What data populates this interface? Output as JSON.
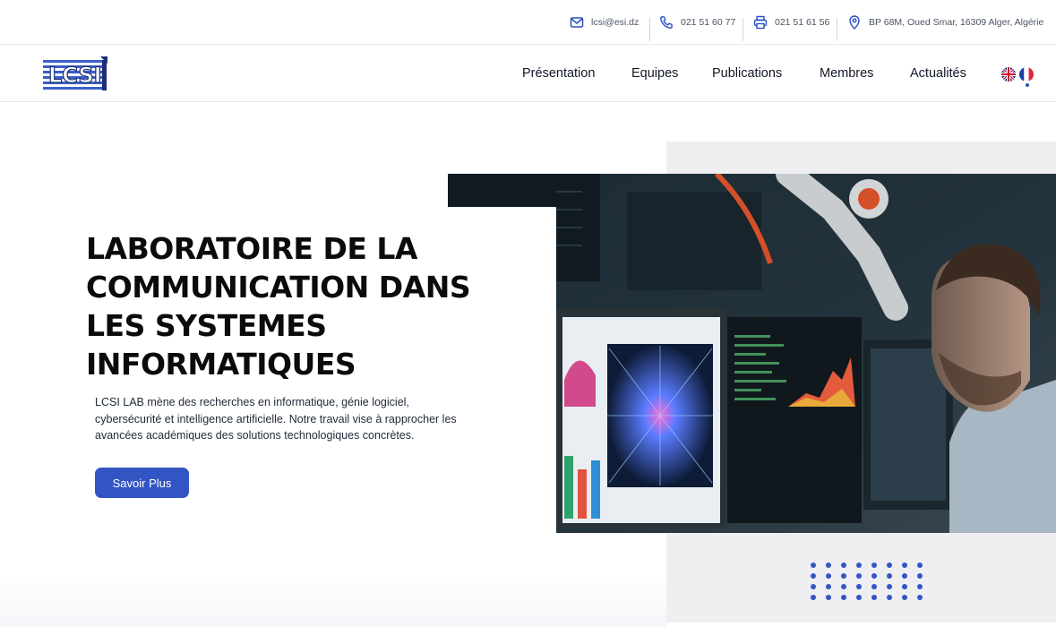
{
  "topbar": {
    "email": "lcsi@esi.dz",
    "phone": "021 51 60 77",
    "fax": "021 51 61 56",
    "address": "BP 68M, Oued Smar, 16309 Alger, Algérie",
    "icons": [
      "mail-icon",
      "phone-icon",
      "printer-icon",
      "location-pin-icon"
    ]
  },
  "navbar": {
    "logo_text": "LCSI",
    "items": [
      "Présentation",
      "Equipes",
      "Publications",
      "Membres",
      "Actualités"
    ],
    "languages": [
      "en-flag-icon",
      "fr-flag-icon"
    ]
  },
  "hero": {
    "title_lines": [
      "LABORATOIRE DE LA",
      "COMMUNICATION DANS",
      "LES SYSTEMES",
      "INFORMATIQUES"
    ],
    "description": "LCSI LAB mène des recherches en informatique, génie logiciel, cybersécurité et intelligence artificielle. Notre travail vise à rapprocher les avancées académiques des solutions technologiques concrètes.",
    "cta_label": "Savoir Plus"
  },
  "colors": {
    "accent": "#3355c4",
    "text": "#111827",
    "muted": "#4b5563",
    "panel": "#efeff1"
  }
}
